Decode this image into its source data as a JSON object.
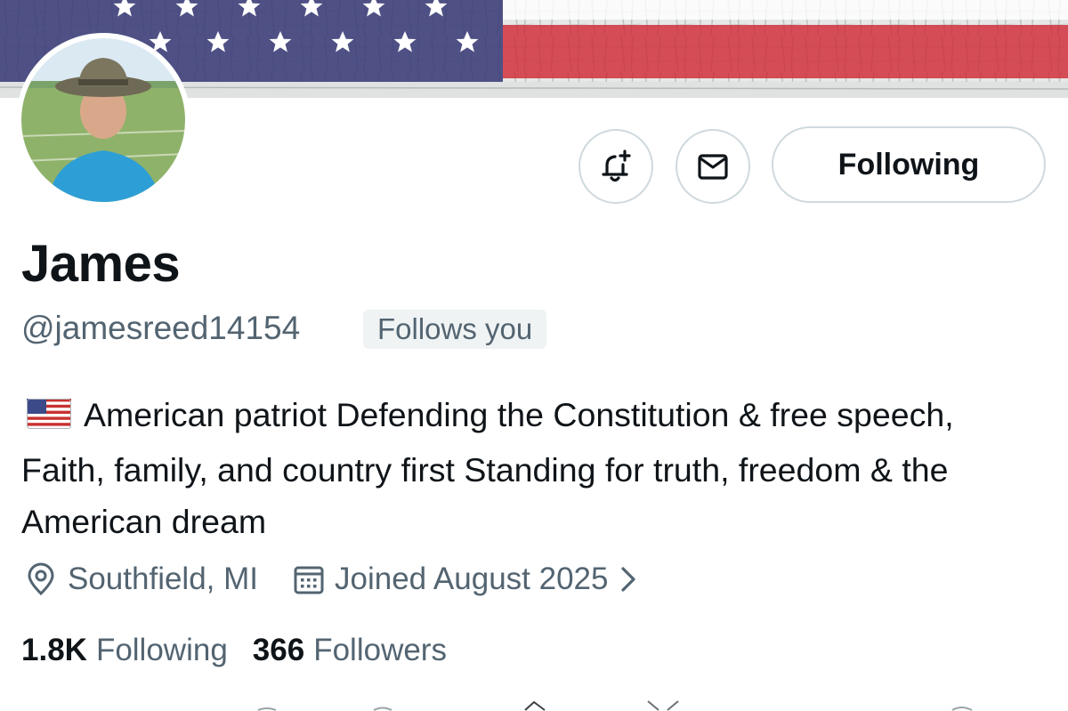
{
  "banner": {
    "description_icon": "american-flag-banner"
  },
  "profile": {
    "display_name": "James",
    "handle": "@jamesreed14154",
    "follows_you_label": "Follows you",
    "bio_flag_icon": "us-flag-emoji",
    "bio_text": "American patriot Defending the Constitution & free speech, Faith, family, and country first Standing for truth, freedom & the American dream",
    "location": "Southfield, MI",
    "joined": "Joined August 2025",
    "following_count": "1.8K",
    "following_label": "Following",
    "followers_count": "366",
    "followers_label": "Followers"
  },
  "actions": {
    "notify_icon": "bell-plus-icon",
    "message_icon": "envelope-icon",
    "following_button": "Following"
  },
  "colors": {
    "text_primary": "#0f1419",
    "text_secondary": "#536471",
    "border": "#cfd9de",
    "badge_bg": "#eff3f4"
  }
}
